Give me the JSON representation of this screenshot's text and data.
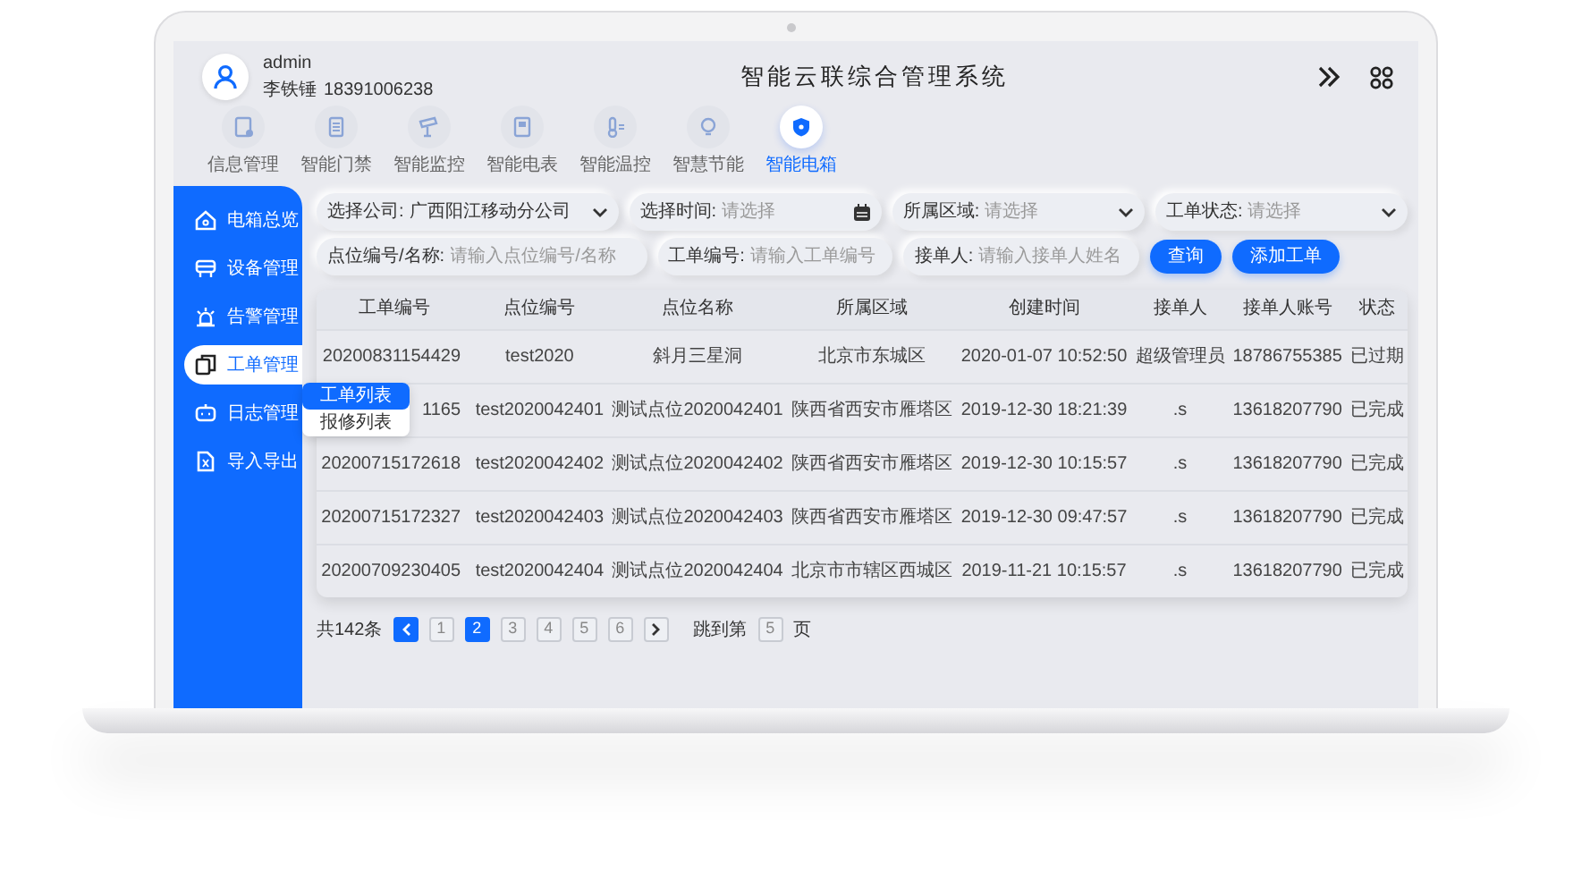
{
  "user": {
    "account": "admin",
    "name": "李铁锤",
    "phone": "18391006238"
  },
  "title": "智能云联综合管理系统",
  "modules": [
    {
      "label": "信息管理",
      "selected": false
    },
    {
      "label": "智能门禁",
      "selected": false
    },
    {
      "label": "智能监控",
      "selected": false
    },
    {
      "label": "智能电表",
      "selected": false
    },
    {
      "label": "智能温控",
      "selected": false
    },
    {
      "label": "智慧节能",
      "selected": false
    },
    {
      "label": "智能电箱",
      "selected": true
    }
  ],
  "sidebar": {
    "items": [
      {
        "label": "电箱总览",
        "selected": false
      },
      {
        "label": "设备管理",
        "selected": false
      },
      {
        "label": "告警管理",
        "selected": false
      },
      {
        "label": "工单管理",
        "selected": true,
        "submenu": [
          {
            "label": "工单列表",
            "selected": true
          },
          {
            "label": "报修列表",
            "selected": false
          }
        ]
      },
      {
        "label": "日志管理",
        "selected": false
      },
      {
        "label": "导入导出",
        "selected": false
      }
    ]
  },
  "filters": {
    "row_1": [
      {
        "kind": "select",
        "label": "选择公司:",
        "value": "广西阳江移动分公司"
      },
      {
        "kind": "date",
        "label": "选择时间:",
        "placeholder": "请选择"
      },
      {
        "kind": "select",
        "label": "所属区域:",
        "placeholder": "请选择"
      },
      {
        "kind": "select",
        "label": "工单状态:",
        "placeholder": "请选择"
      }
    ],
    "row_2": [
      {
        "kind": "text",
        "label": "点位编号/名称:",
        "placeholder": "请输入点位编号/名称"
      },
      {
        "kind": "text",
        "label": "工单编号:",
        "placeholder": "请输入工单编号"
      },
      {
        "kind": "text",
        "label": "接单人:",
        "placeholder": "请输入接单人姓名"
      }
    ],
    "buttons": [
      "查询",
      "添加工单"
    ]
  },
  "table": {
    "columns": [
      "工单编号",
      "点位编号",
      "点位名称",
      "所属区域",
      "创建时间",
      "接单人",
      "接单人账号",
      "状态"
    ],
    "rows": [
      [
        "20200831154429",
        "test2020",
        "斜月三星洞",
        "北京市东城区",
        "2020-01-07 10:52:50",
        "超级管理员",
        "18786755385",
        "已过期"
      ],
      [
        "1165",
        "test2020042401",
        "测试点位2020042401",
        "陕西省西安市雁塔区",
        "2019-12-30 18:21:39",
        ".s",
        "13618207790",
        "已完成"
      ],
      [
        "20200715172618",
        "test2020042402",
        "测试点位2020042402",
        "陕西省西安市雁塔区",
        "2019-12-30 10:15:57",
        ".s",
        "13618207790",
        "已完成"
      ],
      [
        "20200715172327",
        "test2020042403",
        "测试点位2020042403",
        "陕西省西安市雁塔区",
        "2019-12-30 09:47:57",
        ".s",
        "13618207790",
        "已完成"
      ],
      [
        "20200709230405",
        "test2020042404",
        "测试点位2020042404",
        "北京市市辖区西城区",
        "2019-11-21 10:15:57",
        ".s",
        "13618207790",
        "已完成"
      ]
    ]
  },
  "pagination": {
    "total": "共142条",
    "pages": [
      {
        "label": "1",
        "selected": false
      },
      {
        "label": "2",
        "selected": true
      },
      {
        "label": "3",
        "selected": false
      },
      {
        "label": "4",
        "selected": false
      },
      {
        "label": "5",
        "selected": false
      },
      {
        "label": "6",
        "selected": false
      }
    ],
    "jump_label": "跳到第",
    "jump_value": "5",
    "suffix": "页"
  }
}
